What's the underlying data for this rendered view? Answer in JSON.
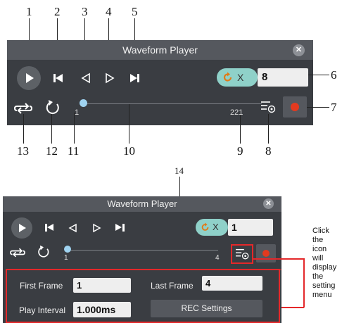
{
  "callouts": [
    "1",
    "2",
    "3",
    "4",
    "5",
    "6",
    "7",
    "8",
    "9",
    "10",
    "11",
    "12",
    "13",
    "14"
  ],
  "player_top": {
    "title": "Waveform Player",
    "close_icon": "close-icon",
    "loop_count_prefix": "X",
    "loop_count_value": "8",
    "slider_start": "1",
    "slider_end": "221",
    "icons": {
      "play": "play-icon",
      "first": "skip-to-first-icon",
      "prev": "step-back-icon",
      "next": "step-forward-icon",
      "last": "skip-to-last-icon",
      "loop": "loop-icon",
      "refresh": "refresh-icon",
      "settings": "settings-menu-icon",
      "record": "record-icon"
    }
  },
  "player_bottom": {
    "title": "Waveform Player",
    "loop_count_prefix": "X",
    "loop_count_value": "1",
    "slider_start": "1",
    "slider_end": "4",
    "settings": {
      "first_frame_label": "First Frame",
      "first_frame_value": "1",
      "last_frame_label": "Last Frame",
      "last_frame_value": "4",
      "play_interval_label": "Play Interval",
      "play_interval_value": "1.000ms",
      "rec_settings_label": "REC Settings"
    }
  },
  "note_lines": [
    "Click",
    "the",
    "icon",
    "will",
    "display",
    "the",
    "setting",
    "menu"
  ],
  "colors": {
    "panel": "#3a3d42",
    "titlebar": "#55585e",
    "accent_pill": "#8fd1c9",
    "knob": "#9fd3f0",
    "record": "#e23a1f",
    "highlight": "#e4282a"
  }
}
